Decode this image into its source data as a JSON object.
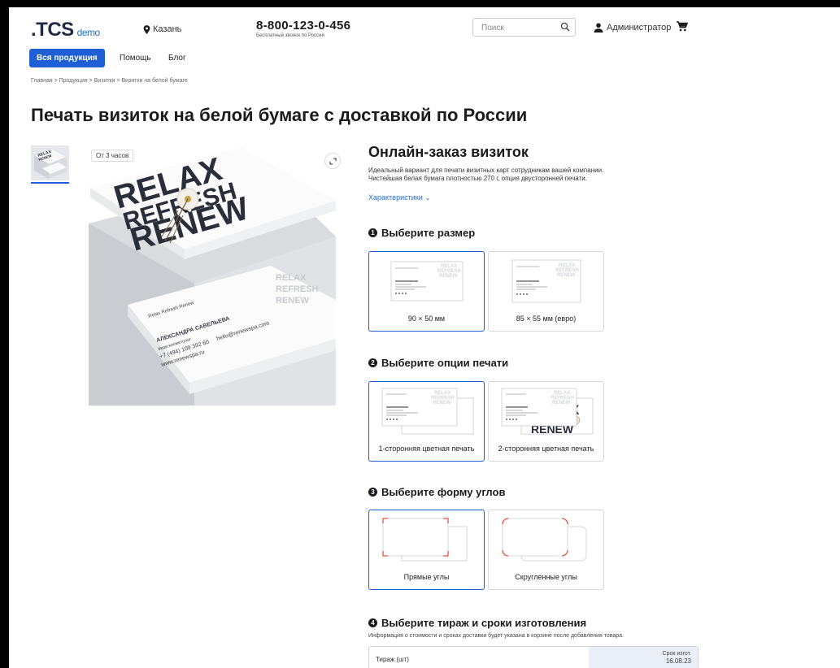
{
  "header": {
    "logo": ".TCS",
    "logo_suffix": "demo",
    "city": "Казань",
    "phone": "8-800-123-0-456",
    "phone_note": "Бесплатный звонок по России",
    "search_placeholder": "Поиск",
    "user": "Администратор"
  },
  "nav": {
    "primary": "Вся продукция",
    "items": [
      "Помощь",
      "Блог"
    ]
  },
  "breadcrumb": "Главная > Продукция > Визитки > Визитки на белой бумаге",
  "page_title": "Печать визиток на белой бумаге с доставкой по России",
  "gallery": {
    "badge": "От 3 часов",
    "mockup_words": [
      "RELAX",
      "REFRESH",
      "RENEW"
    ],
    "card_brand": "Relax Refresh Renew",
    "card_name": "АЛЕКСАНДРА САВЕЛЬЕВА",
    "card_role": "веди косметолог",
    "card_phone": "+7 (494) 109 392 60",
    "card_email": "hello@renewspa.com",
    "card_site": "www.renewspa.ru"
  },
  "product": {
    "title": "Онлайн-заказ визиток",
    "description_1": "Идеальный вариант для печати визитных карт сотрудникам вашей компании.",
    "description_2": "Чистейшая белая бумага плотностью 270 г, опция двусторонней печати.",
    "specs_link": "Характеристики ⌄"
  },
  "steps": [
    {
      "num": "1",
      "title": "Выберите размер",
      "options": [
        "90 × 50 мм",
        "85 × 55 мм (евро)"
      ]
    },
    {
      "num": "2",
      "title": "Выберите опции печати",
      "options": [
        "1-сторонняя цветная печать",
        "2-сторонняя цветная печать"
      ]
    },
    {
      "num": "3",
      "title": "Выберите форму углов",
      "options": [
        "Прямые углы",
        "Скругленные углы"
      ]
    },
    {
      "num": "4",
      "title": "Выберите тираж и сроки изготовления",
      "options": []
    }
  ],
  "step4_note": "Информация о стоимости и сроках доставки будет указана в корзине после добавления товара.",
  "table": {
    "left_header": "Тираж (шт)",
    "right_header_1": "Срок изгот.",
    "right_header_2": "16.08.23"
  },
  "colors": {
    "accent": "#1e5fd6",
    "link": "#1e6fd9",
    "text": "#1b1b1f",
    "corner_mark": "#e8553e"
  }
}
